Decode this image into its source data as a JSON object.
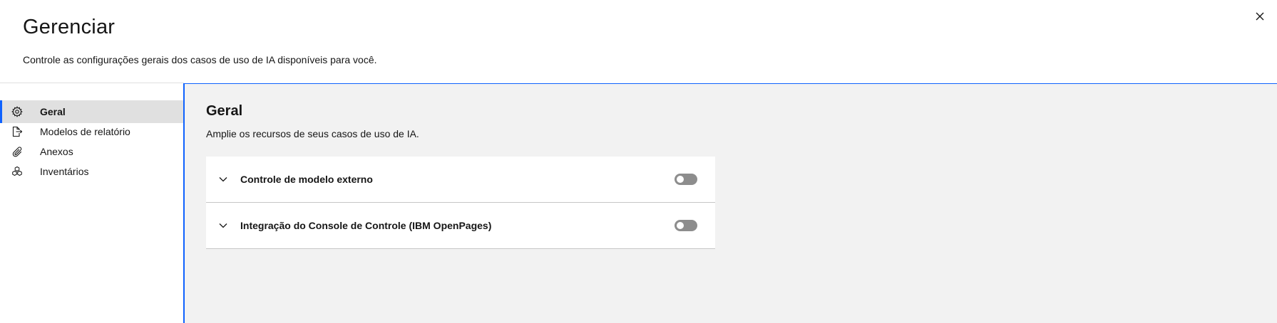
{
  "modal": {
    "title": "Gerenciar",
    "subtitle": "Controle as configurações gerais dos casos de uso de IA disponíveis para você.",
    "close_icon": "close-icon"
  },
  "sidebar": {
    "items": [
      {
        "label": "Geral",
        "icon": "settings-icon",
        "active": true
      },
      {
        "label": "Modelos de relatório",
        "icon": "document-export-icon",
        "active": false
      },
      {
        "label": "Anexos",
        "icon": "attachment-icon",
        "active": false
      },
      {
        "label": "Inventários",
        "icon": "inventory-icon",
        "active": false
      }
    ]
  },
  "main": {
    "title": "Geral",
    "description": "Amplie os recursos de seus casos de uso de IA.",
    "accordion": [
      {
        "label": "Controle de modelo externo",
        "expanded": false,
        "toggle_on": false
      },
      {
        "label": "Integração do Console de Controle (IBM OpenPages)",
        "expanded": false,
        "toggle_on": false
      }
    ]
  },
  "colors": {
    "accent": "#0f62fe",
    "content_bg": "#f2f2f2",
    "active_nav_bg": "#e0e0e0",
    "toggle_off": "#8d8d8d"
  }
}
